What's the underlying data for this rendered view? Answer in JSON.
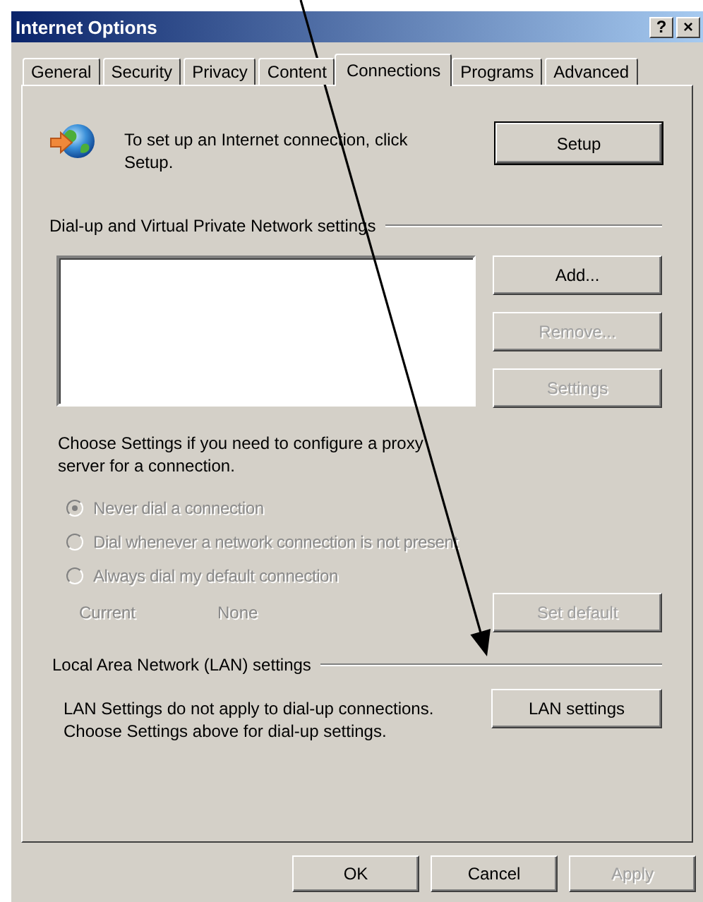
{
  "window": {
    "title": "Internet Options",
    "help_button": "?",
    "close_button": "×"
  },
  "tabs": [
    {
      "label": "General",
      "selected": false
    },
    {
      "label": "Security",
      "selected": false
    },
    {
      "label": "Privacy",
      "selected": false
    },
    {
      "label": "Content",
      "selected": false
    },
    {
      "label": "Connections",
      "selected": true
    },
    {
      "label": "Programs",
      "selected": false
    },
    {
      "label": "Advanced",
      "selected": false
    }
  ],
  "setup": {
    "text": "To set up an Internet connection, click Setup.",
    "button": {
      "label": "Setup",
      "disabled": false
    }
  },
  "dialup": {
    "heading": "Dial-up and Virtual Private Network settings",
    "buttons": [
      {
        "label": "Add...",
        "disabled": false
      },
      {
        "label": "Remove...",
        "disabled": true
      },
      {
        "label": "Settings",
        "disabled": true
      }
    ],
    "proxy_text": "Choose Settings if you need to configure a proxy server for a connection.",
    "radios": [
      {
        "label": "Never dial a connection",
        "selected": true,
        "disabled": true
      },
      {
        "label": "Dial whenever a network connection is not present",
        "selected": false,
        "disabled": true
      },
      {
        "label": "Always dial my default connection",
        "selected": false,
        "disabled": true
      }
    ],
    "current_label": "Current",
    "current_value": "None",
    "current_disabled": true,
    "set_default": {
      "label": "Set default",
      "disabled": true
    }
  },
  "lan": {
    "heading": "Local Area Network (LAN) settings",
    "text": "LAN Settings do not apply to dial-up connections. Choose Settings above for dial-up settings.",
    "button": {
      "label": "LAN settings",
      "disabled": false
    }
  },
  "footer": [
    {
      "label": "OK",
      "disabled": false
    },
    {
      "label": "Cancel",
      "disabled": false
    },
    {
      "label": "Apply",
      "disabled": true
    }
  ]
}
